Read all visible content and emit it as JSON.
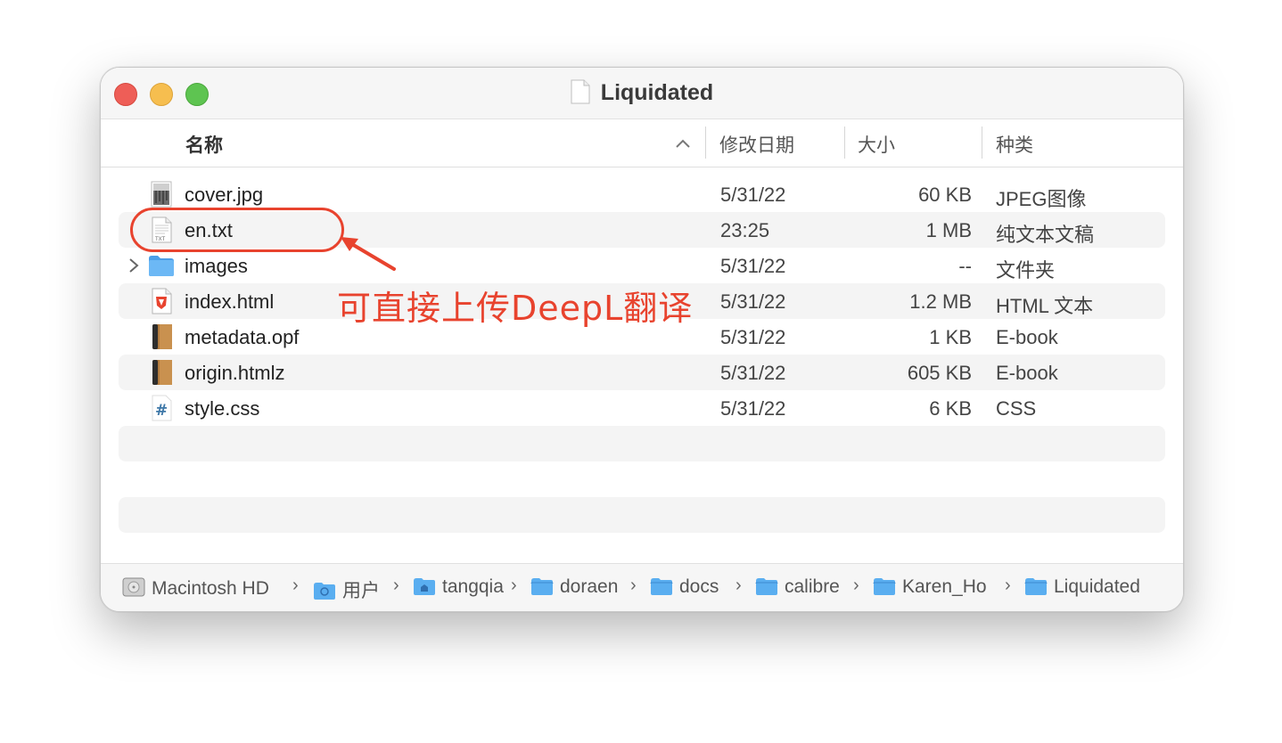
{
  "window": {
    "title": "Liquidated"
  },
  "columns": {
    "name": "名称",
    "date": "修改日期",
    "size": "大小",
    "kind": "种类"
  },
  "files": [
    {
      "name": "cover.jpg",
      "date": "5/31/22",
      "size": "60 KB",
      "kind": "JPEG图像",
      "icon": "image-file-icon"
    },
    {
      "name": "en.txt",
      "date": "23:25",
      "size": "1 MB",
      "kind": "纯文本文稿",
      "icon": "text-file-icon"
    },
    {
      "name": "images",
      "date": "5/31/22",
      "size": "--",
      "kind": "文件夹",
      "icon": "folder-icon"
    },
    {
      "name": "index.html",
      "date": "5/31/22",
      "size": "1.2 MB",
      "kind": "HTML 文本",
      "icon": "html-file-icon"
    },
    {
      "name": "metadata.opf",
      "date": "5/31/22",
      "size": "1 KB",
      "kind": "E-book",
      "icon": "ebook-icon"
    },
    {
      "name": "origin.htmlz",
      "date": "5/31/22",
      "size": "605 KB",
      "kind": "E-book",
      "icon": "ebook-icon"
    },
    {
      "name": "style.css",
      "date": "5/31/22",
      "size": "6 KB",
      "kind": "CSS",
      "icon": "css-file-icon"
    }
  ],
  "annotation": {
    "text": "可直接上传DeepL翻译",
    "color": "#e8432e"
  },
  "pathbar": [
    {
      "label": "Macintosh HD",
      "icon": "hard-drive-icon"
    },
    {
      "label": "用户",
      "icon": "users-folder-icon"
    },
    {
      "label": "tangqia",
      "icon": "home-folder-icon"
    },
    {
      "label": "doraen",
      "icon": "folder-icon"
    },
    {
      "label": "docs",
      "icon": "folder-icon"
    },
    {
      "label": "calibre",
      "icon": "folder-icon"
    },
    {
      "label": "Karen_Ho",
      "icon": "folder-icon"
    },
    {
      "label": "Liquidated",
      "icon": "folder-icon"
    }
  ],
  "colors": {
    "close": "#ee5e57",
    "minimize": "#f6be4f",
    "zoom": "#5ec451",
    "folder": "#5aaef0"
  }
}
